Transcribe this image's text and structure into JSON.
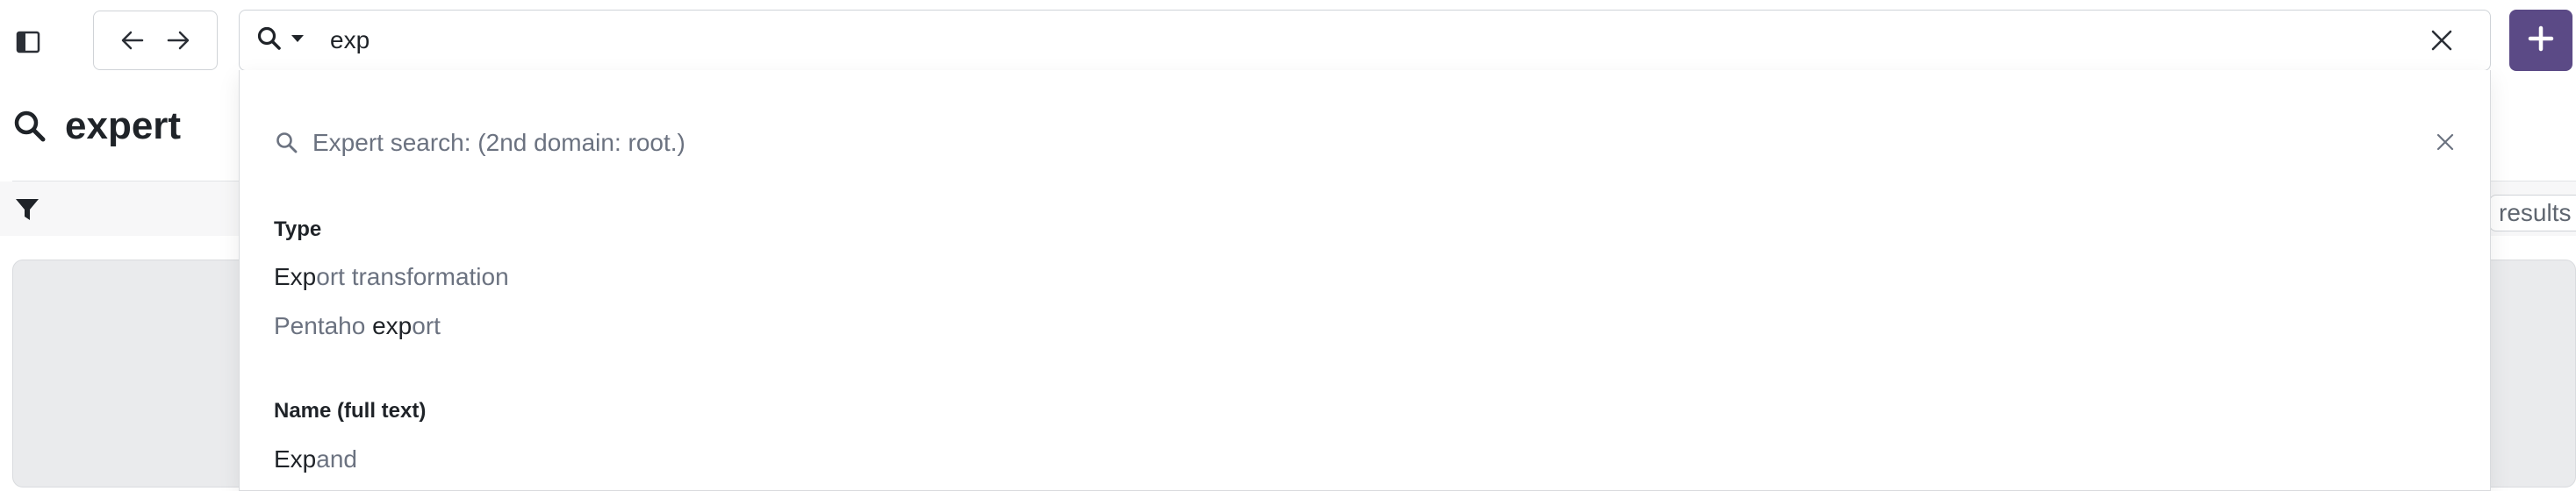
{
  "search": {
    "value": "exp",
    "placeholder": ""
  },
  "page": {
    "title": "expert",
    "results_label": "results"
  },
  "dropdown": {
    "expert_search_label": "Expert search: (2nd domain: root.)",
    "groups": [
      {
        "heading": "Type",
        "items": [
          {
            "pre": "",
            "match": "Exp",
            "post": "ort transformation"
          },
          {
            "pre": "Pentaho ",
            "match": "exp",
            "post": "ort"
          }
        ]
      },
      {
        "heading": "Name (full text)",
        "items": [
          {
            "pre": "",
            "match": "Exp",
            "post": "and"
          }
        ]
      }
    ]
  },
  "icons": {
    "sidebar_toggle": "sidebar-panel-icon",
    "back": "arrow-left-icon",
    "forward": "arrow-right-icon",
    "search": "magnifier-icon",
    "mode_dropdown": "caret-down-icon",
    "clear": "close-icon",
    "add": "plus-icon",
    "filter": "funnel-icon"
  },
  "colors": {
    "accent": "#5b4a86",
    "muted_text": "#6b7280",
    "text": "#1f2328"
  }
}
